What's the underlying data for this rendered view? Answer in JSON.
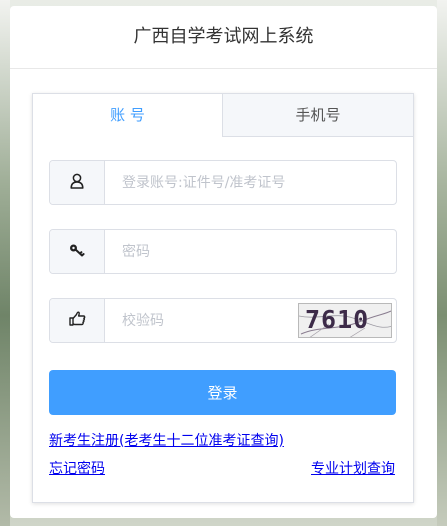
{
  "panel": {
    "title": "广西自学考试网上系统"
  },
  "tabs": [
    {
      "label": "账 号",
      "active": true
    },
    {
      "label": "手机号",
      "active": false
    }
  ],
  "form": {
    "account_placeholder": "登录账号:证件号/准考证号",
    "account_value": "",
    "password_placeholder": "密码",
    "password_value": "",
    "captcha_placeholder": "校验码",
    "captcha_value": "",
    "captcha_image_text": "7610",
    "login_label": "登录"
  },
  "links": {
    "register": "新考生注册(老考生十二位准考证查询)",
    "forgot_password": "忘记密码",
    "plan_query": "专业计划查询"
  },
  "icons": {
    "account": "user-icon",
    "password": "key-icon",
    "captcha": "hand-pointer-icon"
  },
  "colors": {
    "accent": "#409eff",
    "link": "#0000ee",
    "captcha_text": "#3d2b49"
  }
}
